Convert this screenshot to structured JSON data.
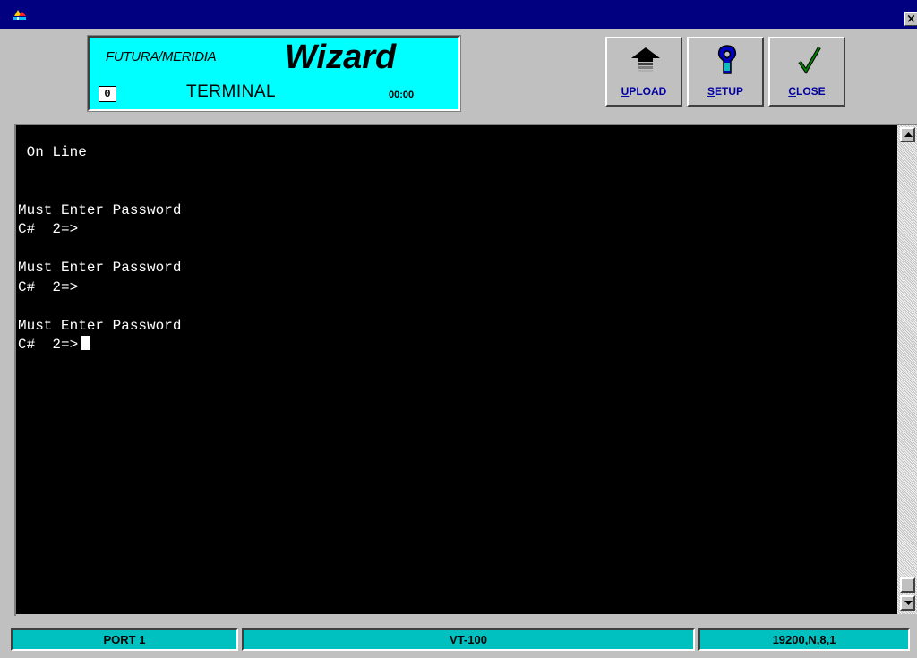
{
  "window": {
    "title": "",
    "close_glyph": "×",
    "icon": "app-icon",
    "title_bar_color": "#000080"
  },
  "banner": {
    "brand": "FUTURA/MERIDIA",
    "title": "Wizard",
    "counter": "0",
    "mode": "TERMINAL",
    "time": "00:00",
    "background": "#00ffff"
  },
  "toolbar": {
    "upload": {
      "label_first": "U",
      "label_rest": "PLOAD",
      "icon": "upload-arrow-icon"
    },
    "setup": {
      "label_first": "S",
      "label_rest": "ETUP",
      "icon": "wrench-icon"
    },
    "close": {
      "label_first": "C",
      "label_rest": "LOSE",
      "icon": "checkmark-icon"
    },
    "label_color": "#0000a0"
  },
  "terminal": {
    "lines": [
      " On Line",
      "",
      "",
      "Must Enter Password",
      "C#  2=>",
      "",
      "Must Enter Password",
      "C#  2=>",
      "",
      "Must Enter Password",
      "C#  2=>"
    ],
    "background": "#000000",
    "foreground": "#ffffff"
  },
  "status": {
    "port": "PORT 1",
    "emulation": "VT-100",
    "settings": "19200,N,8,1",
    "panel_color": "#00c0c0"
  }
}
